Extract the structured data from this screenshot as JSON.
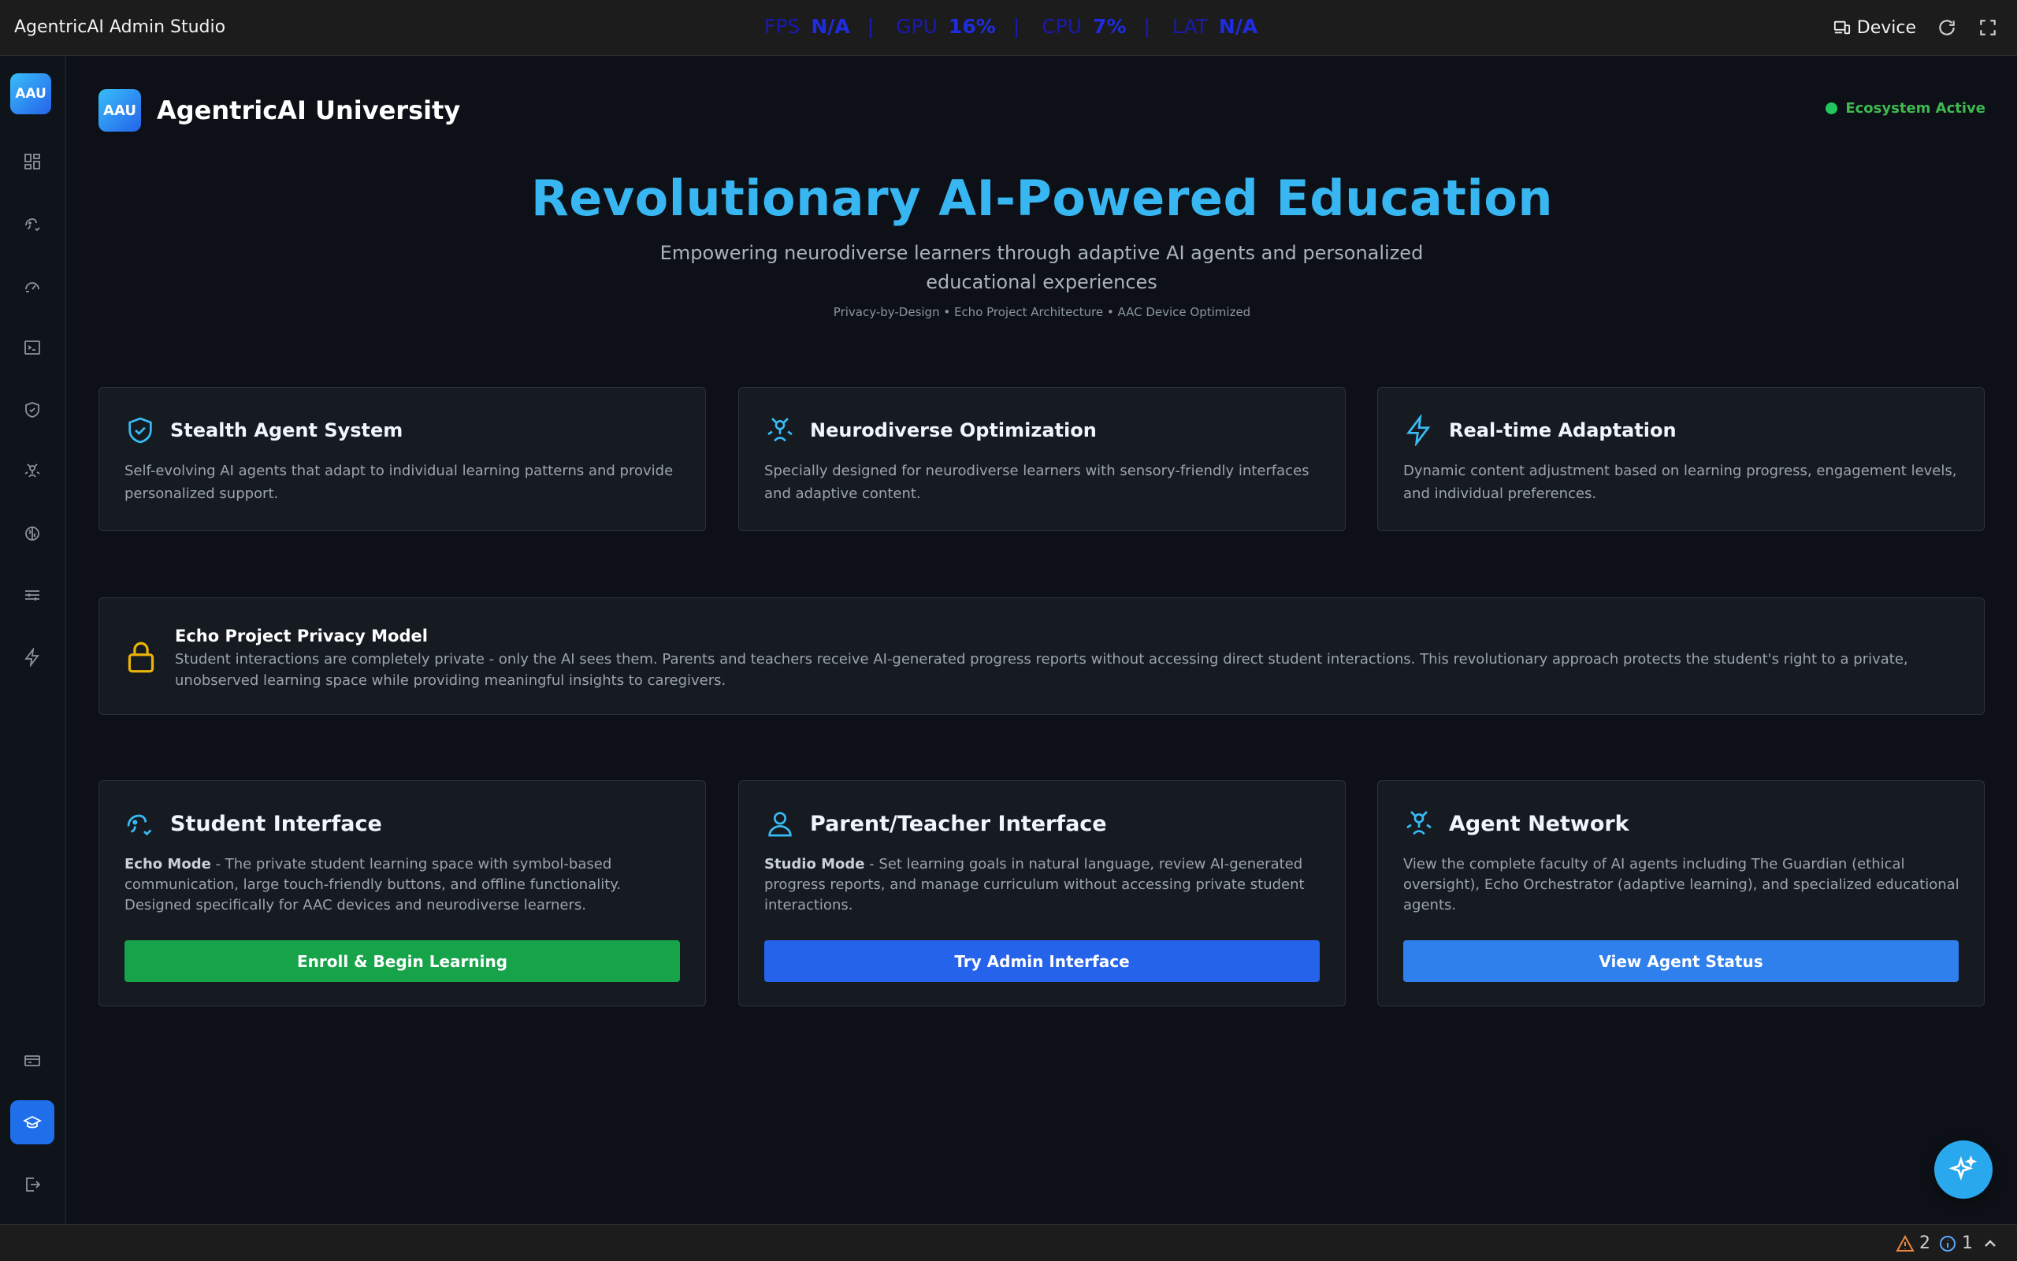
{
  "app": {
    "title": "AgentricAI Admin Studio"
  },
  "metrics": [
    {
      "label": "FPS",
      "value": "N/A"
    },
    {
      "label": "GPU",
      "value": "16%"
    },
    {
      "label": "CPU",
      "value": "7%"
    },
    {
      "label": "LAT",
      "value": "N/A"
    }
  ],
  "topbar": {
    "device_label": "Device",
    "refresh_icon": "refresh-icon",
    "fullscreen_icon": "fullscreen-icon"
  },
  "sidebar": {
    "logo": "AAU",
    "items": [
      {
        "icon": "dashboard-icon"
      },
      {
        "icon": "agent-icon"
      },
      {
        "icon": "gauge-icon"
      },
      {
        "icon": "terminal-icon"
      },
      {
        "icon": "shield-icon"
      },
      {
        "icon": "neural-icon"
      },
      {
        "icon": "brain-icon"
      },
      {
        "icon": "layers-icon"
      },
      {
        "icon": "bolt-icon"
      },
      {
        "icon": "card-icon"
      },
      {
        "icon": "graduation-cap-icon",
        "active": true
      },
      {
        "icon": "logout-icon"
      }
    ]
  },
  "brand": {
    "logo": "AAU",
    "name": "AgentricAI University"
  },
  "ecosystem": {
    "status": "Ecosystem Active",
    "color": "#22c55e"
  },
  "hero": {
    "title": "Revolutionary AI-Powered Education",
    "subtitle": "Empowering neurodiverse learners through adaptive AI agents and personalized educational experiences",
    "tags": "Privacy-by-Design • Echo Project Architecture • AAC Device Optimized"
  },
  "features": [
    {
      "icon": "shield-check-icon",
      "title": "Stealth Agent System",
      "description": "Self-evolving AI agents that adapt to individual learning patterns and provide personalized support."
    },
    {
      "icon": "neural-icon",
      "title": "Neurodiverse Optimization",
      "description": "Specially designed for neurodiverse learners with sensory-friendly interfaces and adaptive content."
    },
    {
      "icon": "bolt-icon",
      "title": "Real-time Adaptation",
      "description": "Dynamic content adjustment based on learning progress, engagement levels, and individual preferences."
    }
  ],
  "privacy": {
    "title": "Echo Project Privacy Model",
    "description": "Student interactions are completely private - only the AI sees them. Parents and teachers receive AI-generated progress reports without accessing direct student interactions. This revolutionary approach protects the student's right to a private, unobserved learning space while providing meaningful insights to caregivers."
  },
  "interfaces": [
    {
      "icon": "agent-icon",
      "title": "Student Interface",
      "mode": "Echo Mode",
      "description": " - The private student learning space with symbol-based communication, large touch-friendly buttons, and offline functionality. Designed specifically for AAC devices and neurodiverse learners.",
      "button": "Enroll & Begin Learning",
      "button_color": "#16a34a"
    },
    {
      "icon": "user-icon",
      "title": "Parent/Teacher Interface",
      "mode": "Studio Mode",
      "description": " - Set learning goals in natural language, review AI-generated progress reports, and manage curriculum without accessing private student interactions.",
      "button": "Try Admin Interface",
      "button_color": "#2563eb"
    },
    {
      "icon": "neural-icon",
      "title": "Agent Network",
      "mode": "",
      "description": "View the complete faculty of AI agents including The Guardian (ethical oversight), Echo Orchestrator (adaptive learning), and specialized educational agents.",
      "button": "View Agent Status",
      "button_color": "#2f80ed"
    }
  ],
  "fab": {
    "icon": "sparkles-icon"
  },
  "statusbar": {
    "warnings": "2",
    "info": "1"
  }
}
